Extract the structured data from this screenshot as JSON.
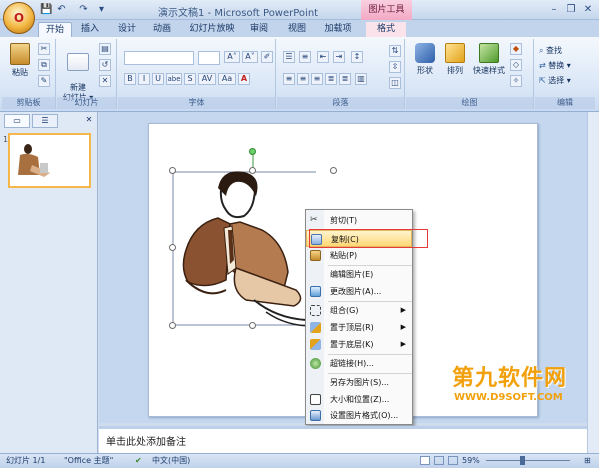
{
  "titlebar": {
    "title": "演示文稿1 - Microsoft PowerPoint",
    "context_tab_title": "图片工具",
    "office_button_label": "O"
  },
  "qat": {
    "save": "💾",
    "undo": "↶",
    "redo": "↷",
    "more": "▾"
  },
  "tabs": [
    {
      "label": "开始",
      "active": true
    },
    {
      "label": "插入"
    },
    {
      "label": "设计"
    },
    {
      "label": "动画"
    },
    {
      "label": "幻灯片放映"
    },
    {
      "label": "审阅"
    },
    {
      "label": "视图"
    },
    {
      "label": "加载项"
    },
    {
      "label": "格式"
    }
  ],
  "window_controls": {
    "minimize": "–",
    "restore": "❐",
    "close": "✕"
  },
  "ribbon": {
    "clipboard": {
      "label": "剪贴板",
      "paste": "粘贴"
    },
    "slides": {
      "label": "幻灯片",
      "new_slide": "新建\n幻灯片 ▾"
    },
    "font": {
      "label": "字体",
      "buttons": [
        "B",
        "I",
        "U",
        "abe",
        "S",
        "AV",
        "Aa",
        "A"
      ],
      "grow": "A˄",
      "shrink": "A˅"
    },
    "paragraph": {
      "label": "段落"
    },
    "drawing": {
      "label": "绘图",
      "shapes": "形状",
      "arrange": "排列",
      "quick_styles": "快速样式"
    },
    "editing": {
      "label": "编辑",
      "find": "查找",
      "replace": "替换 ▾",
      "select": "选择 ▾"
    }
  },
  "thumbnails": {
    "tab_slides": "",
    "tab_outline": "",
    "slide_number": "1"
  },
  "slide": {},
  "context_menu": {
    "items": [
      {
        "label": "剪切(T)",
        "icon": "scissors-icon"
      },
      {
        "label": "复制(C)",
        "icon": "copy-icon",
        "highlighted": true
      },
      {
        "label": "粘贴(P)",
        "icon": "paste-icon"
      },
      {
        "separator": true
      },
      {
        "label": "编辑图片(E)"
      },
      {
        "label": "更改图片(A)...",
        "icon": "change-picture-icon"
      },
      {
        "separator": true
      },
      {
        "label": "组合(G)",
        "icon": "group-icon",
        "submenu": true
      },
      {
        "label": "置于顶层(R)",
        "icon": "bring-front-icon",
        "submenu": true
      },
      {
        "label": "置于底层(K)",
        "icon": "send-back-icon",
        "submenu": true
      },
      {
        "separator": true
      },
      {
        "label": "超链接(H)...",
        "icon": "hyperlink-icon"
      },
      {
        "separator": true
      },
      {
        "label": "另存为图片(S)..."
      },
      {
        "label": "大小和位置(Z)...",
        "icon": "size-position-icon"
      },
      {
        "label": "设置图片格式(O)...",
        "icon": "format-picture-icon"
      }
    ]
  },
  "notes": {
    "placeholder": "单击此处添加备注"
  },
  "status": {
    "slide_info": "幻灯片 1/1",
    "theme": "\"Office 主题\"",
    "language": "中文(中国)",
    "zoom": "59%"
  },
  "watermark": {
    "text": "第九软件网",
    "url": "WWW.D9SOFT.COM"
  },
  "colors": {
    "accent": "#f5b64a",
    "ribbon_bg": "#dbe7f7",
    "highlight": "#ffd874",
    "red_box": "#e53a3a"
  }
}
